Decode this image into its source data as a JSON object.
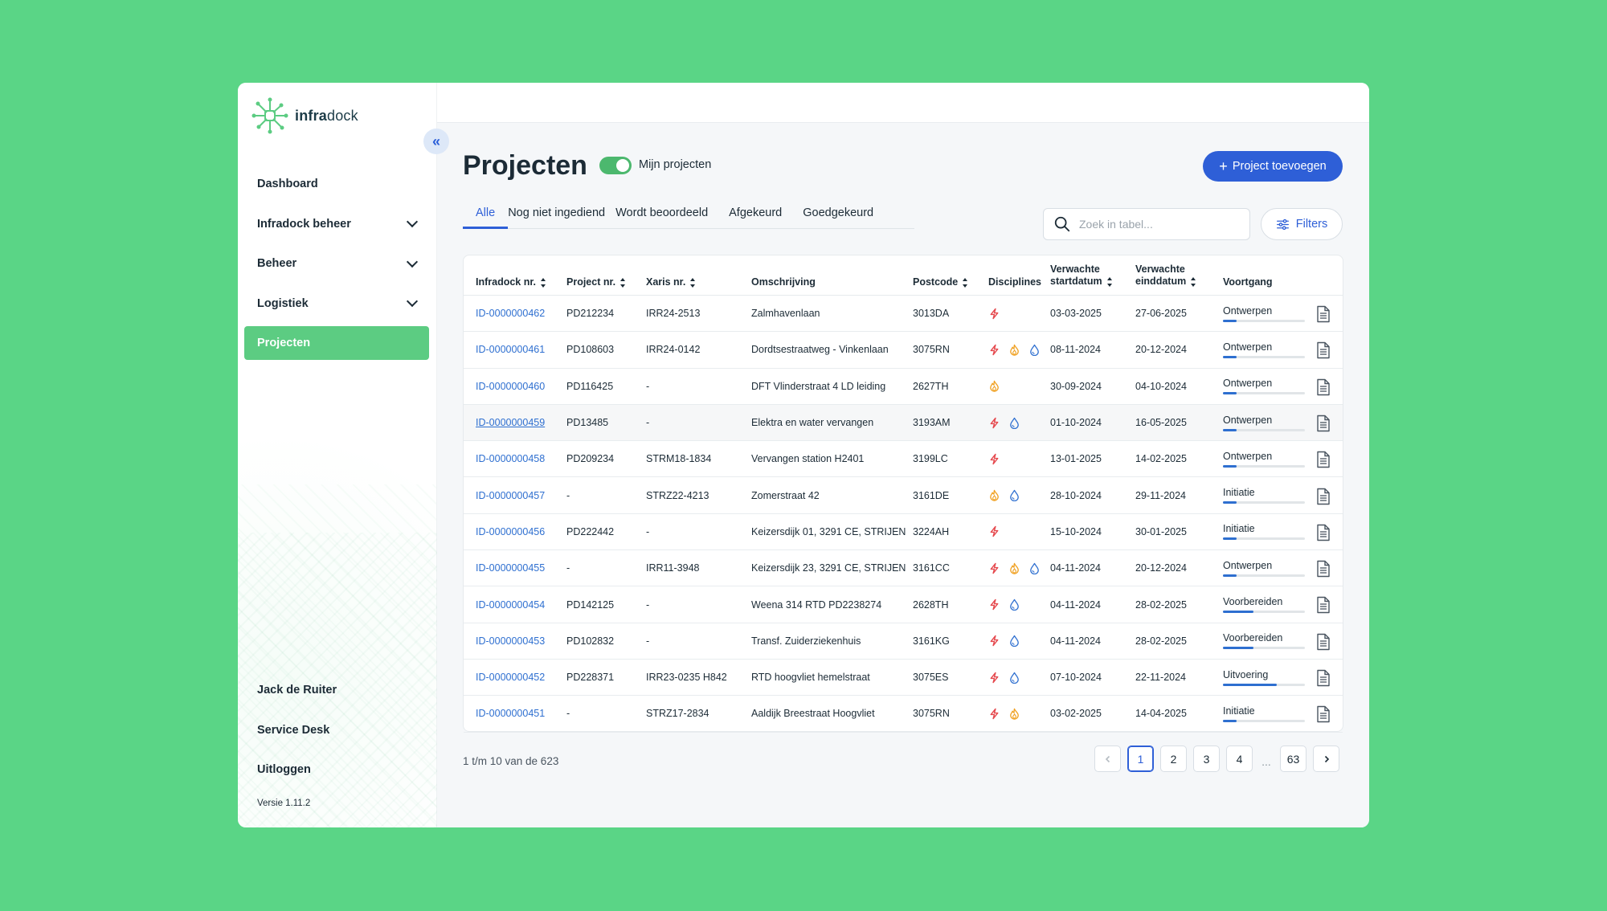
{
  "brand": {
    "name_bold": "infra",
    "name_thin": "dock",
    "accent": "#5ccc82",
    "primary": "#2e5fd7"
  },
  "sidebar": {
    "items": [
      {
        "label": "Dashboard",
        "expandable": false,
        "active": false
      },
      {
        "label": "Infradock beheer",
        "expandable": true,
        "active": false
      },
      {
        "label": "Beheer",
        "expandable": true,
        "active": false
      },
      {
        "label": "Logistiek",
        "expandable": true,
        "active": false
      },
      {
        "label": "Projecten",
        "expandable": false,
        "active": true
      }
    ],
    "bottom": {
      "user": "Jack de Ruiter",
      "service_desk": "Service Desk",
      "logout": "Uitloggen"
    },
    "version": "Versie 1.11.2",
    "collapse_icon": "«"
  },
  "header": {
    "title": "Projecten",
    "toggle_label": "Mijn projecten",
    "toggle_on": true,
    "add_button": "Project toevoegen",
    "add_plus": "+"
  },
  "tabs": [
    {
      "label": "Alle",
      "active": true
    },
    {
      "label": "Nog niet ingediend",
      "active": false
    },
    {
      "label": "Wordt beoordeeld",
      "active": false
    },
    {
      "label": "Afgekeurd",
      "active": false
    },
    {
      "label": "Goedgekeurd",
      "active": false
    }
  ],
  "search": {
    "placeholder": "Zoek in tabel..."
  },
  "filters_label": "Filters",
  "table": {
    "columns": {
      "id": "Infradock nr.",
      "project": "Project nr.",
      "xaris": "Xaris nr.",
      "desc": "Omschrijving",
      "postcode": "Postcode",
      "disciplines": "Disciplines",
      "start_1": "Verwachte",
      "start_2": "startdatum",
      "end_1": "Verwachte",
      "end_2": "einddatum",
      "progress": "Voortgang"
    },
    "rows": [
      {
        "id": "ID-0000000462",
        "project": "PD212234",
        "xaris": "IRR24-2513",
        "desc": "Zalmhavenlaan",
        "postcode": "3013DA",
        "disc": [
          "electricity-icon"
        ],
        "start": "03-03-2025",
        "end": "27-06-2025",
        "status": "Ontwerpen",
        "progress": 0.17
      },
      {
        "id": "ID-0000000461",
        "project": "PD108603",
        "xaris": "IRR24-0142",
        "desc": "Dordtsestraatweg - Vinkenlaan",
        "postcode": "3075RN",
        "disc": [
          "electricity-icon",
          "gas-icon",
          "water-icon"
        ],
        "start": "08-11-2024",
        "end": "20-12-2024",
        "status": "Ontwerpen",
        "progress": 0.17
      },
      {
        "id": "ID-0000000460",
        "project": "PD116425",
        "xaris": "-",
        "desc": "DFT Vlinderstraat 4 LD leiding",
        "postcode": "2627TH",
        "disc": [
          "gas-icon"
        ],
        "start": "30-09-2024",
        "end": "04-10-2024",
        "status": "Ontwerpen",
        "progress": 0.17
      },
      {
        "id": "ID-0000000459",
        "project": "PD13485",
        "xaris": "-",
        "desc": "Elektra en water vervangen",
        "postcode": "3193AM",
        "disc": [
          "electricity-icon",
          "water-icon"
        ],
        "start": "01-10-2024",
        "end": "16-05-2025",
        "status": "Ontwerpen",
        "progress": 0.17,
        "alt": true,
        "linked": true
      },
      {
        "id": "ID-0000000458",
        "project": "PD209234",
        "xaris": "STRM18-1834",
        "desc": "Vervangen station H2401",
        "postcode": "3199LC",
        "disc": [
          "electricity-icon"
        ],
        "start": "13-01-2025",
        "end": "14-02-2025",
        "status": "Ontwerpen",
        "progress": 0.17
      },
      {
        "id": "ID-0000000457",
        "project": "-",
        "xaris": "STRZ22-4213",
        "desc": "Zomerstraat 42",
        "postcode": "3161DE",
        "disc": [
          "gas-icon",
          "water-icon"
        ],
        "start": "28-10-2024",
        "end": "29-11-2024",
        "status": "Initiatie",
        "progress": 0.17
      },
      {
        "id": "ID-0000000456",
        "project": "PD222442",
        "xaris": "-",
        "desc": "Keizersdijk 01, 3291 CE, STRIJEN",
        "postcode": "3224AH",
        "disc": [
          "electricity-icon"
        ],
        "start": "15-10-2024",
        "end": "30-01-2025",
        "status": "Initiatie",
        "progress": 0.17
      },
      {
        "id": "ID-0000000455",
        "project": "-",
        "xaris": "IRR11-3948",
        "desc": "Keizersdijk 23, 3291 CE, STRIJEN",
        "postcode": "3161CC",
        "disc": [
          "electricity-icon",
          "gas-icon",
          "water-icon"
        ],
        "start": "04-11-2024",
        "end": "20-12-2024",
        "status": "Ontwerpen",
        "progress": 0.17
      },
      {
        "id": "ID-0000000454",
        "project": "PD142125",
        "xaris": "-",
        "desc": "Weena 314 RTD PD2238274",
        "postcode": "2628TH",
        "disc": [
          "electricity-icon",
          "water-icon"
        ],
        "start": "04-11-2024",
        "end": "28-02-2025",
        "status": "Voorbereiden",
        "progress": 0.37
      },
      {
        "id": "ID-0000000453",
        "project": "PD102832",
        "xaris": "-",
        "desc": "Transf. Zuiderziekenhuis",
        "postcode": "3161KG",
        "disc": [
          "electricity-icon",
          "water-icon"
        ],
        "start": "04-11-2024",
        "end": "28-02-2025",
        "status": "Voorbereiden",
        "progress": 0.37
      },
      {
        "id": "ID-0000000452",
        "project": "PD228371",
        "xaris": "IRR23-0235 H842",
        "desc": "RTD hoogvliet hemelstraat",
        "postcode": "3075ES",
        "disc": [
          "electricity-icon",
          "water-icon"
        ],
        "start": "07-10-2024",
        "end": "22-11-2024",
        "status": "Uitvoering",
        "progress": 0.66
      },
      {
        "id": "ID-0000000451",
        "project": "-",
        "xaris": "STRZ17-2834",
        "desc": "Aaldijk Breestraat Hoogvliet",
        "postcode": "3075RN",
        "disc": [
          "electricity-icon",
          "gas-icon"
        ],
        "start": "03-02-2025",
        "end": "14-04-2025",
        "status": "Initiatie",
        "progress": 0.17
      }
    ]
  },
  "pagination": {
    "info": "1 t/m 10 van de 623",
    "pages": [
      "1",
      "2",
      "3",
      "4"
    ],
    "ellipsis": "...",
    "last": "63",
    "current": "1"
  },
  "colors": {
    "electricity": "#e5484d",
    "gas": "#f0a020",
    "water": "#2e6fd0"
  }
}
